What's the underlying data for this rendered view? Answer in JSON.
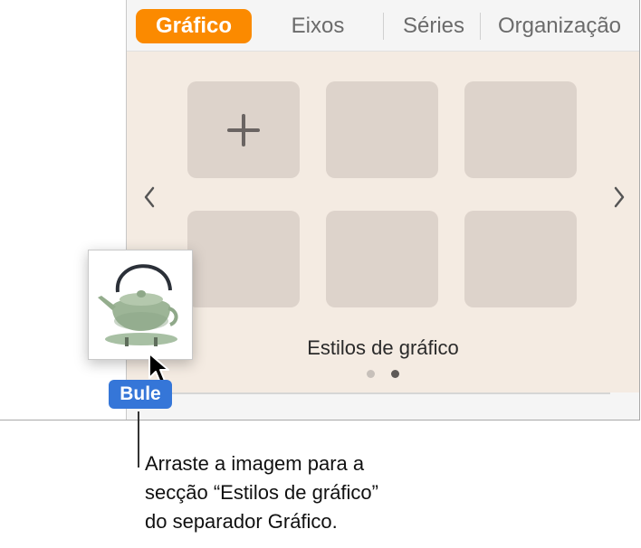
{
  "tabs": [
    {
      "label": "Gráfico",
      "active": true
    },
    {
      "label": "Eixos",
      "active": false
    },
    {
      "label": "Séries",
      "active": false
    },
    {
      "label": "Organização",
      "active": false
    }
  ],
  "styles_panel": {
    "title": "Estilos de gráfico",
    "add_tile_icon": "plus-icon",
    "tiles_count": 6,
    "page_indicator": {
      "pages": 2,
      "current": 2
    },
    "prev_icon": "chevron-left-icon",
    "next_icon": "chevron-right-icon"
  },
  "drag": {
    "image_subject": "teapot-icon",
    "label": "Bule"
  },
  "callout": {
    "lines": [
      "Arraste a imagem para a",
      "secção “Estilos de gráfico”",
      "do separador Gráfico."
    ]
  },
  "colors": {
    "accent": "#fb8a00",
    "label_blue": "#3576d8",
    "panel_bg": "#f4ebe2",
    "tile_bg": "#ddd3cb"
  }
}
